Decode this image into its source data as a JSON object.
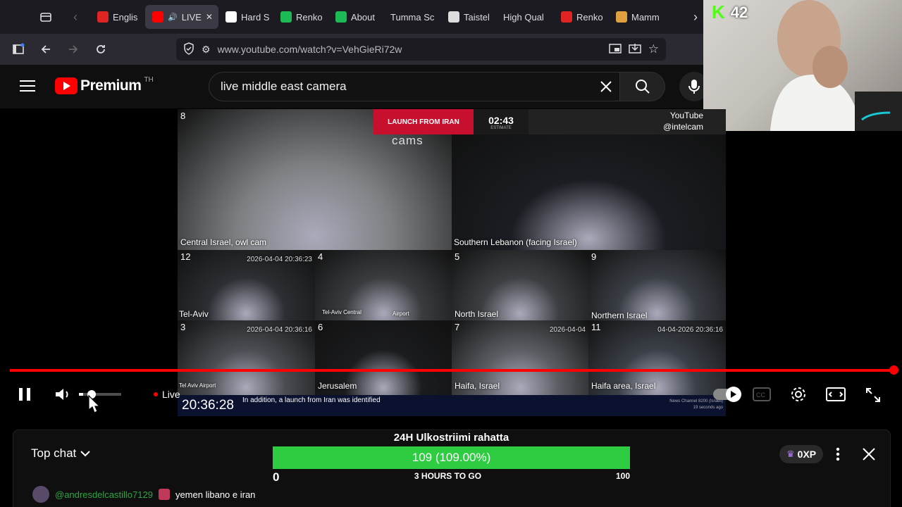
{
  "browser": {
    "tabs": [
      {
        "label": "Englis",
        "color": "#e02424"
      },
      {
        "label": "LIVE",
        "color": "#ff0000"
      },
      {
        "label": "Hard S",
        "color": "#ffffff"
      },
      {
        "label": "Renko",
        "color": "#1db954"
      },
      {
        "label": "About",
        "color": "#1db954"
      },
      {
        "label": "Tumma Sc",
        "color": "#6a6a6a"
      },
      {
        "label": "Taistel",
        "color": "#dddddd"
      },
      {
        "label": "High Qual",
        "color": "#6a6a6a"
      },
      {
        "label": "Renko",
        "color": "#e02424"
      },
      {
        "label": "Mamm",
        "color": "#e0a040"
      }
    ],
    "url": "www.youtube.com/watch?v=VehGieRi72w"
  },
  "youtube": {
    "brand": "Premium",
    "brand_sup": "TH",
    "search_value": "live middle east camera"
  },
  "video": {
    "banner": "LAUNCH FROM IRAN",
    "timer": "02:43",
    "timer_sub": "ESTIMATE",
    "watermark": "cams",
    "channel_line1": "YouTube",
    "channel_line2": "@intelcam",
    "cells": [
      {
        "num": "8",
        "label": "Central Israel, owl cam"
      },
      {
        "num": "",
        "label": "Southern Lebanon (facing Israel)"
      },
      {
        "num": "12",
        "label": "Tel-Aviv",
        "stamp": "2026-04-04 20:36:23"
      },
      {
        "num": "4",
        "label": "Tel-Aviv Central",
        "label2": "Airport"
      },
      {
        "num": "5",
        "label": "North Israel"
      },
      {
        "num": "9",
        "label": "Northern Israel"
      },
      {
        "num": "3",
        "label": "Tel Aviv Airport",
        "stamp": "2026-04-04 20:36:16"
      },
      {
        "num": "6",
        "label": "Jerusalem"
      },
      {
        "num": "7",
        "label": "Haifa, Israel",
        "stamp": "2026-04-04"
      },
      {
        "num": "11",
        "label": "Haifa area, Israel",
        "stamp": "04-04-2026 20:36:16"
      }
    ],
    "clock": "20:36:28",
    "ticker": "In addition, a launch from Iran was identified",
    "news_source": "News Channel 8200 (Israeli)",
    "news_time": "19 seconds ago"
  },
  "controls": {
    "live_label": "Live",
    "progress_fraction": 1.0,
    "volume_fraction": 0.1,
    "accent": "#ff0000"
  },
  "overlay": {
    "k_count": "42"
  },
  "chat": {
    "mode_label": "Top chat",
    "goal_title": "24H Ulkostriimi rahatta",
    "goal_value_text": "109 (109.00%)",
    "goal_fraction": 1.0,
    "goal_min": "0",
    "goal_max": "100",
    "goal_sub": "3 HOURS TO GO",
    "xp_label": "0XP",
    "message_user": "@andresdelcastillo7129",
    "message_text": "yemen libano e iran"
  }
}
